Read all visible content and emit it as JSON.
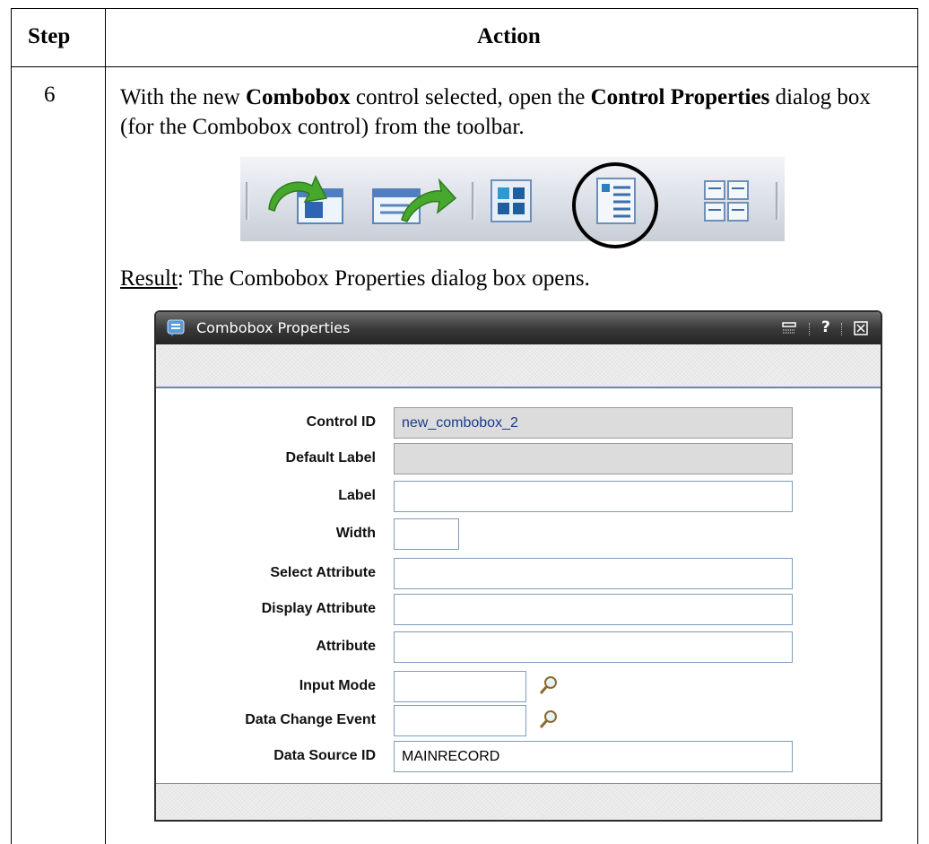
{
  "table": {
    "header_step": "Step",
    "header_action": "Action",
    "step_number": "6",
    "instruction": {
      "part1": "With the new ",
      "bold1": "Combobox",
      "part2": " control selected, open the ",
      "bold2": "Control Properties",
      "part3": " dialog box (for the Combobox control) from the toolbar."
    },
    "result_label": "Result",
    "result_text": ": The Combobox Properties dialog box opens."
  },
  "toolbar": {
    "icons": [
      "import-arrow-icon",
      "export-arrow-icon",
      "grid-layout-icon",
      "control-properties-icon",
      "multi-panel-icon"
    ],
    "highlighted": "control-properties-icon"
  },
  "dialog": {
    "title": "Combobox Properties",
    "controls": {
      "help": "?"
    },
    "fields": [
      {
        "label": "Control ID",
        "value": "new_combobox_2"
      },
      {
        "label": "Default Label",
        "value": ""
      },
      {
        "label": "Label",
        "value": ""
      },
      {
        "label": "Width",
        "value": ""
      },
      {
        "label": "Select Attribute",
        "value": ""
      },
      {
        "label": "Display Attribute",
        "value": ""
      },
      {
        "label": "Attribute",
        "value": ""
      },
      {
        "label": "Input Mode",
        "value": ""
      },
      {
        "label": "Data Change Event",
        "value": ""
      },
      {
        "label": "Data Source ID",
        "value": "MAINRECORD"
      }
    ]
  },
  "colors": {
    "titlebar": "#3a3a3a",
    "field_border": "#7f9db9",
    "readonly_field": "#dcdcdc",
    "highlight_circle": "#000000"
  }
}
